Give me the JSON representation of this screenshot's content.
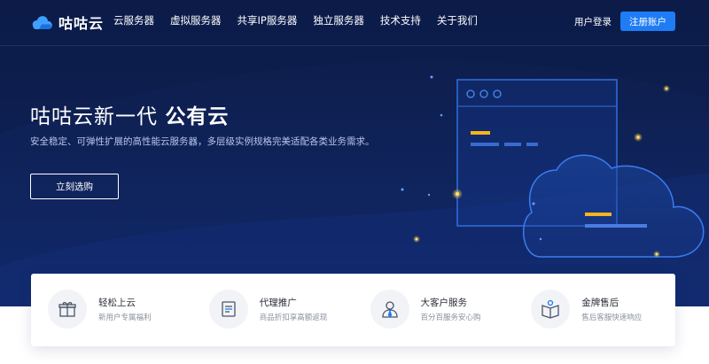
{
  "header": {
    "logo_text": "咕咕云",
    "nav": [
      {
        "label": "云服务器"
      },
      {
        "label": "虚拟服务器"
      },
      {
        "label": "共享IP服务器"
      },
      {
        "label": "独立服务器"
      },
      {
        "label": "技术支持"
      },
      {
        "label": "关于我们"
      }
    ],
    "login_label": "用户登录",
    "register_label": "注册账户"
  },
  "hero": {
    "title_prefix": "咕咕云新一代 ",
    "title_bold": "公有云",
    "subtitle": "安全稳定、可弹性扩展的高性能云服务器，多层级实例规格完美适配各类业务需求。",
    "cta_label": "立刻选购"
  },
  "features": [
    {
      "title": "轻松上云",
      "desc": "新用户专属福利",
      "icon": "gift-icon"
    },
    {
      "title": "代理推广",
      "desc": "商品折扣享高额返现",
      "icon": "document-icon"
    },
    {
      "title": "大客户服务",
      "desc": "百分百服务安心购",
      "icon": "user-service-icon"
    },
    {
      "title": "金牌售后",
      "desc": "售后客服快速响应",
      "icon": "book-support-icon"
    }
  ],
  "colors": {
    "hero_bg": "#0f2257",
    "accent": "#1f7cf5",
    "highlight": "#f5b51c"
  }
}
